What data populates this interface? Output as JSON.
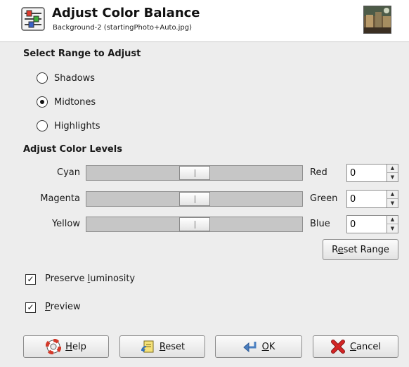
{
  "dialog": {
    "title": "Adjust Color Balance",
    "subtitle": "Background-2 (startingPhoto+Auto.jpg)"
  },
  "range": {
    "section_title": "Select Range to Adjust",
    "options": [
      {
        "label": "Shadows",
        "checked": false
      },
      {
        "label": "Midtones",
        "checked": true
      },
      {
        "label": "Highlights",
        "checked": false
      }
    ]
  },
  "levels": {
    "section_title": "Adjust Color Levels",
    "rows": [
      {
        "left": "Cyan",
        "right": "Red",
        "value": "0",
        "position": 0.5
      },
      {
        "left": "Magenta",
        "right": "Green",
        "value": "0",
        "position": 0.5
      },
      {
        "left": "Yellow",
        "right": "Blue",
        "value": "0",
        "position": 0.5
      }
    ],
    "reset_range_pre": "R",
    "reset_range_u": "e",
    "reset_range_post": "set Range"
  },
  "options": {
    "preserve_pre": "Preserve ",
    "preserve_u": "l",
    "preserve_post": "uminosity",
    "preserve_checked": true,
    "preview_u": "P",
    "preview_post": "review",
    "preview_checked": true
  },
  "buttons": {
    "help_u": "H",
    "help_post": "elp",
    "reset_u": "R",
    "reset_post": "eset",
    "ok_u": "O",
    "ok_post": "K",
    "cancel_u": "C",
    "cancel_post": "ancel"
  },
  "icons": {
    "header": "color-balance-icon",
    "help": "lifebuoy-icon",
    "reset": "reset-icon",
    "ok": "enter-arrow-icon",
    "cancel": "red-x-icon"
  },
  "colors": {
    "ok_arrow": "#4a7fc0",
    "cancel_x": "#d42424",
    "help_ring": "#d43a2a"
  }
}
